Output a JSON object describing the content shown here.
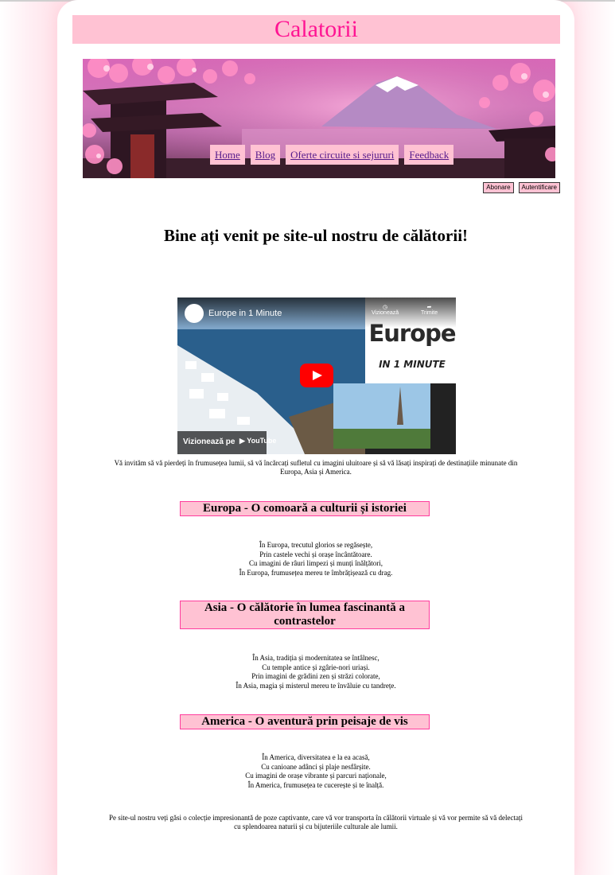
{
  "site": {
    "title": "Calatorii"
  },
  "nav": {
    "items": [
      "Home",
      "Blog",
      "Oferte circuite si sejururi",
      "Feedback"
    ]
  },
  "auth": {
    "subscribe": "Abonare",
    "login": "Autentificare"
  },
  "welcome": "Bine ați venit pe site-ul nostru de călătorii!",
  "video": {
    "title": "Europe in 1 Minute",
    "watch_later": "Vizionează",
    "share": "Trimite",
    "card_big": "Europe",
    "card_small": "IN 1 MINUTE",
    "watch_on": "Vizionează pe",
    "youtube": "YouTube"
  },
  "intro": "Vă invităm să vă pierdeți în frumusețea lumii, să vă încărcați sufletul cu imagini uluitoare și să vă lăsați inspirați de destinațiile minunate din Europa, Asia și America.",
  "sections": [
    {
      "heading": "Europa - O comoară a culturii și istoriei",
      "lines": [
        "În Europa, trecutul glorios se regăsește,",
        "Prin castele vechi și orașe încântătoare.",
        "Cu imagini de râuri limpezi și munți înălțători,",
        "În Europa, frumusețea mereu te îmbrățișează cu drag."
      ]
    },
    {
      "heading": "Asia - O călătorie în lumea fascinantă a contrastelor",
      "lines": [
        "În Asia, tradiția și modernitatea se întâlnesc,",
        "Cu temple antice și zgârie-nori uriași.",
        "Prin imagini de grădini zen și străzi colorate,",
        "În Asia, magia și misterul mereu te învăluie cu tandrețe."
      ]
    },
    {
      "heading": "America - O aventură prin peisaje de vis",
      "lines": [
        "În America, diversitatea e la ea acasă,",
        "Cu canioane adânci și plaje nesfârșite.",
        "Cu imagini de orașe vibrante și parcuri naționale,",
        "În America, frumusețea te cucerește și te înalță."
      ]
    }
  ],
  "closing": "Pe site-ul nostru veți găsi o colecție impresionantă de poze captivante, care vă vor transporta în călătorii virtuale și vă vor permite să vă delectați cu splendoarea naturii și cu bijuteriile culturale ale lumii.",
  "colors": {
    "accent_pink": "#ffc2d3",
    "title_pink": "#ff1493",
    "border_pink": "#ff3c9d",
    "link_purple": "#551a8b"
  }
}
